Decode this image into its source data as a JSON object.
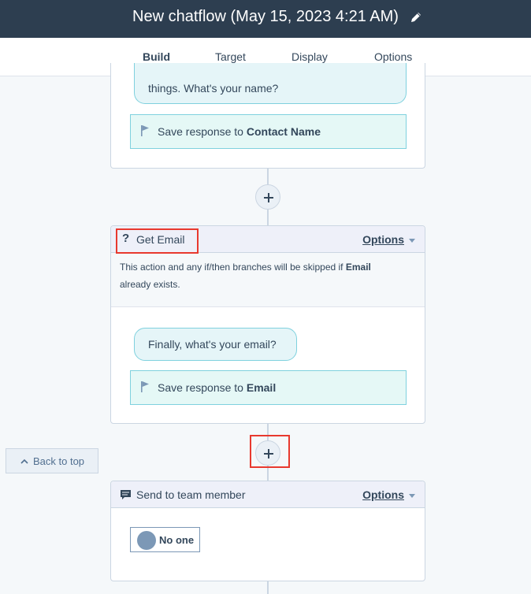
{
  "header": {
    "title": "New chatflow (May 15, 2023 4:21 AM)"
  },
  "tabs": [
    {
      "label": "Build",
      "active": true
    },
    {
      "label": "Target",
      "active": false
    },
    {
      "label": "Display",
      "active": false
    },
    {
      "label": "Options",
      "active": false
    }
  ],
  "card_name": {
    "bubble_text": "things. What's your name?",
    "save_prefix": "Save response to",
    "save_field": "Contact Name"
  },
  "card_email": {
    "title": "Get Email",
    "options_label": "Options",
    "skip_prefix": "This action and any if/then branches will be skipped if",
    "skip_field": "Email",
    "skip_suffix": "already exists.",
    "bubble_text": "Finally, what's your email?",
    "save_prefix": "Save response to",
    "save_field": "Email"
  },
  "back_to_top": {
    "label": "Back to top"
  },
  "card_team": {
    "title": "Send to team member",
    "options_label": "Options",
    "owner_label": "No one"
  },
  "colors": {
    "header_bg": "#2d3e50",
    "accent_teal": "#7fd1de",
    "highlight": "#e8392e"
  }
}
